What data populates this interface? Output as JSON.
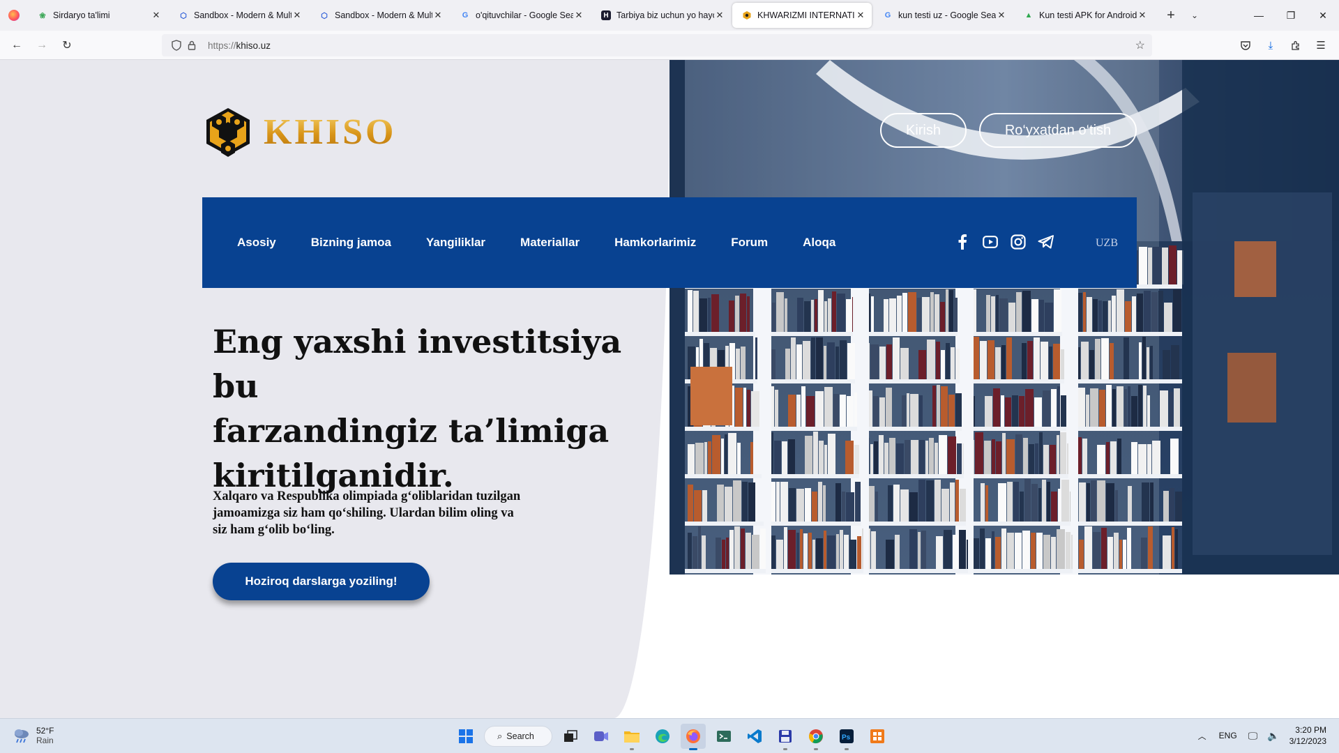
{
  "browser": {
    "tabs": [
      {
        "title": "Sirdaryo ta'limi",
        "favicon": "leaf-icon",
        "active": false
      },
      {
        "title": "Sandbox - Modern & Multi",
        "favicon": "hexagon-icon",
        "active": false
      },
      {
        "title": "Sandbox - Modern & Multi",
        "favicon": "hexagon-icon",
        "active": false
      },
      {
        "title": "o'qituvchilar - Google Searc",
        "favicon": "google-icon",
        "active": false
      },
      {
        "title": "Tarbiya biz uchun yo hayot",
        "favicon": "h-logo-icon",
        "active": false
      },
      {
        "title": "KHWARIZMI INTERNATION",
        "favicon": "khiso-icon",
        "active": true
      },
      {
        "title": "kun testi uz - Google Search",
        "favicon": "google-icon",
        "active": false
      },
      {
        "title": "Kun testi APK for Android D",
        "favicon": "apk-icon",
        "active": false
      }
    ],
    "url_prefix": "https://",
    "url_host": "khiso.uz"
  },
  "site": {
    "logo_text": "KHISO",
    "auth": {
      "login": "Kirish",
      "register": "Ro‘yxatdan o‘tish"
    },
    "nav": [
      "Asosiy",
      "Bizning jamoa",
      "Yangiliklar",
      "Materiallar",
      "Hamkorlarimiz",
      "Forum",
      "Aloqa"
    ],
    "socials": [
      "facebook-icon",
      "youtube-icon",
      "instagram-icon",
      "telegram-icon"
    ],
    "language": "UZB",
    "hero": {
      "title_lines": [
        "Eng yaxshi investitsiya bu",
        "farzandingiz ta’limiga",
        "kiritilganidir."
      ],
      "subtitle_lines": [
        "Xalqaro va Respublika olimpiada g‘oliblaridan tuzilgan",
        "jamoamizga siz ham qo‘shiling. Ulardan bilim oling va",
        "siz ham g‘olib bo‘ling."
      ],
      "cta": "Hoziroq darslarga yoziling!"
    },
    "colors": {
      "primary_blue": "#084291",
      "gold": "#e6a61c",
      "panel_bg": "#e8e8ee"
    }
  },
  "taskbar": {
    "weather": {
      "temp": "52°F",
      "condition": "Rain"
    },
    "search_label": "Search",
    "apps": [
      "start-icon",
      "task-view-icon",
      "teams-icon",
      "file-explorer-icon",
      "edge-icon",
      "firefox-icon",
      "terminal-icon",
      "vscode-icon",
      "save-app-icon",
      "chrome-icon",
      "photoshop-icon",
      "office-app-icon"
    ],
    "tray": {
      "language": "ENG",
      "time": "3:20 PM",
      "date": "3/12/2023"
    }
  }
}
